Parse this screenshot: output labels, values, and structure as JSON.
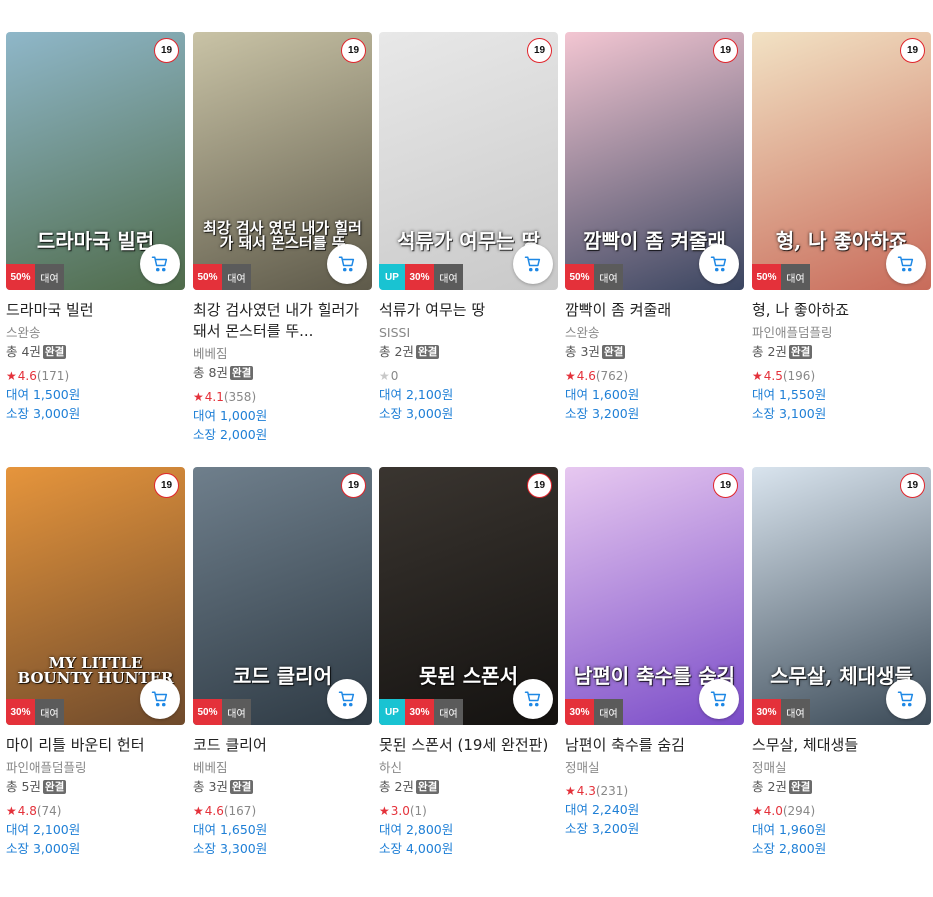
{
  "accent_colors": {
    "sale": "#e4313a",
    "up": "#19c3d2",
    "rent_tag": "#5b5b5b",
    "price": "#1e7fd6",
    "star": "#e4313a"
  },
  "labels": {
    "rent_tag": "대여",
    "up_tag": "UP",
    "age": "19",
    "done": "완결",
    "vols_prefix": "총",
    "vols_suffix": "권",
    "rent_prefix": "대여",
    "own_prefix": "소장"
  },
  "books": [
    {
      "title": "드라마국 빌런",
      "cover_text": "드라마국 빌런",
      "author": "스완송",
      "vols": "4",
      "rating": "4.6",
      "count": "(171)",
      "rent": "1,500원",
      "own": "3,000원",
      "sale": "50%",
      "up": false,
      "cover_color": [
        "#8fb7c9",
        "#4f6b4a"
      ]
    },
    {
      "title": "최강 검사였던 내가 힐러가 돼서 몬스터를 뚜...",
      "cover_text": "최강 검사 였던 내가 힐러가 돼서 몬스터를 뚜",
      "author": "베베짐",
      "vols": "8",
      "rating": "4.1",
      "count": "(358)",
      "rent": "1,000원",
      "own": "2,000원",
      "sale": "50%",
      "up": false,
      "cover_color": [
        "#c9c3a6",
        "#5e5a4a"
      ]
    },
    {
      "title": "석류가 여무는 땅",
      "cover_text": "석류가 여무는 땅",
      "author": "SISSI",
      "vols": "2",
      "rating": "0",
      "count": "",
      "rent": "2,100원",
      "own": "3,000원",
      "sale": "30%",
      "up": true,
      "cover_color": [
        "#e8e8e8",
        "#c9c9c9"
      ]
    },
    {
      "title": "깜빡이 좀 켜줄래",
      "cover_text": "깜빡이 좀 켜줄래",
      "author": "스완송",
      "vols": "3",
      "rating": "4.6",
      "count": "(762)",
      "rent": "1,600원",
      "own": "3,200원",
      "sale": "50%",
      "up": false,
      "cover_color": [
        "#f3c6d2",
        "#3a4560"
      ]
    },
    {
      "title": "형, 나 좋아하죠",
      "cover_text": "형, 나 좋아하죠",
      "author": "파인애플덤플링",
      "vols": "2",
      "rating": "4.5",
      "count": "(196)",
      "rent": "1,550원",
      "own": "3,100원",
      "sale": "50%",
      "up": false,
      "cover_color": [
        "#f2e2c4",
        "#c86b5a"
      ]
    },
    {
      "title": "마이 리틀 바운티 헌터",
      "cover_text": "MY LITTLE BOUNTY HUNTER",
      "author": "파인애플덤플링",
      "vols": "5",
      "rating": "4.8",
      "count": "(74)",
      "rent": "2,100원",
      "own": "3,000원",
      "sale": "30%",
      "up": false,
      "cover_color": [
        "#e6953c",
        "#6e4a2c"
      ]
    },
    {
      "title": "코드 클리어",
      "cover_text": "코드 클리어",
      "author": "베베짐",
      "vols": "3",
      "rating": "4.6",
      "count": "(167)",
      "rent": "1,650원",
      "own": "3,300원",
      "sale": "50%",
      "up": false,
      "cover_color": [
        "#6f7f8c",
        "#2e3a44"
      ]
    },
    {
      "title": "못된 스폰서 (19세 완전판)",
      "cover_text": "못된 스폰서",
      "author": "하신",
      "vols": "2",
      "rating": "3.0",
      "count": "(1)",
      "rent": "2,800원",
      "own": "4,000원",
      "sale": "30%",
      "up": true,
      "cover_color": [
        "#3a3530",
        "#141210"
      ]
    },
    {
      "title": "남편이 축수를 숨김",
      "cover_text": "남편이 축수를 숨김",
      "author": "정매실",
      "vols": "",
      "rating": "4.3",
      "count": "(231)",
      "rent": "2,240원",
      "own": "3,200원",
      "sale": "30%",
      "up": false,
      "cover_color": [
        "#e7c8f0",
        "#7a4cc8"
      ]
    },
    {
      "title": "스무살, 체대생들",
      "cover_text": "스무살, 체대생들",
      "author": "정매실",
      "vols": "2",
      "rating": "4.0",
      "count": "(294)",
      "rent": "1,960원",
      "own": "2,800원",
      "sale": "30%",
      "up": false,
      "cover_color": [
        "#d9e4ee",
        "#3b4a57"
      ]
    }
  ]
}
